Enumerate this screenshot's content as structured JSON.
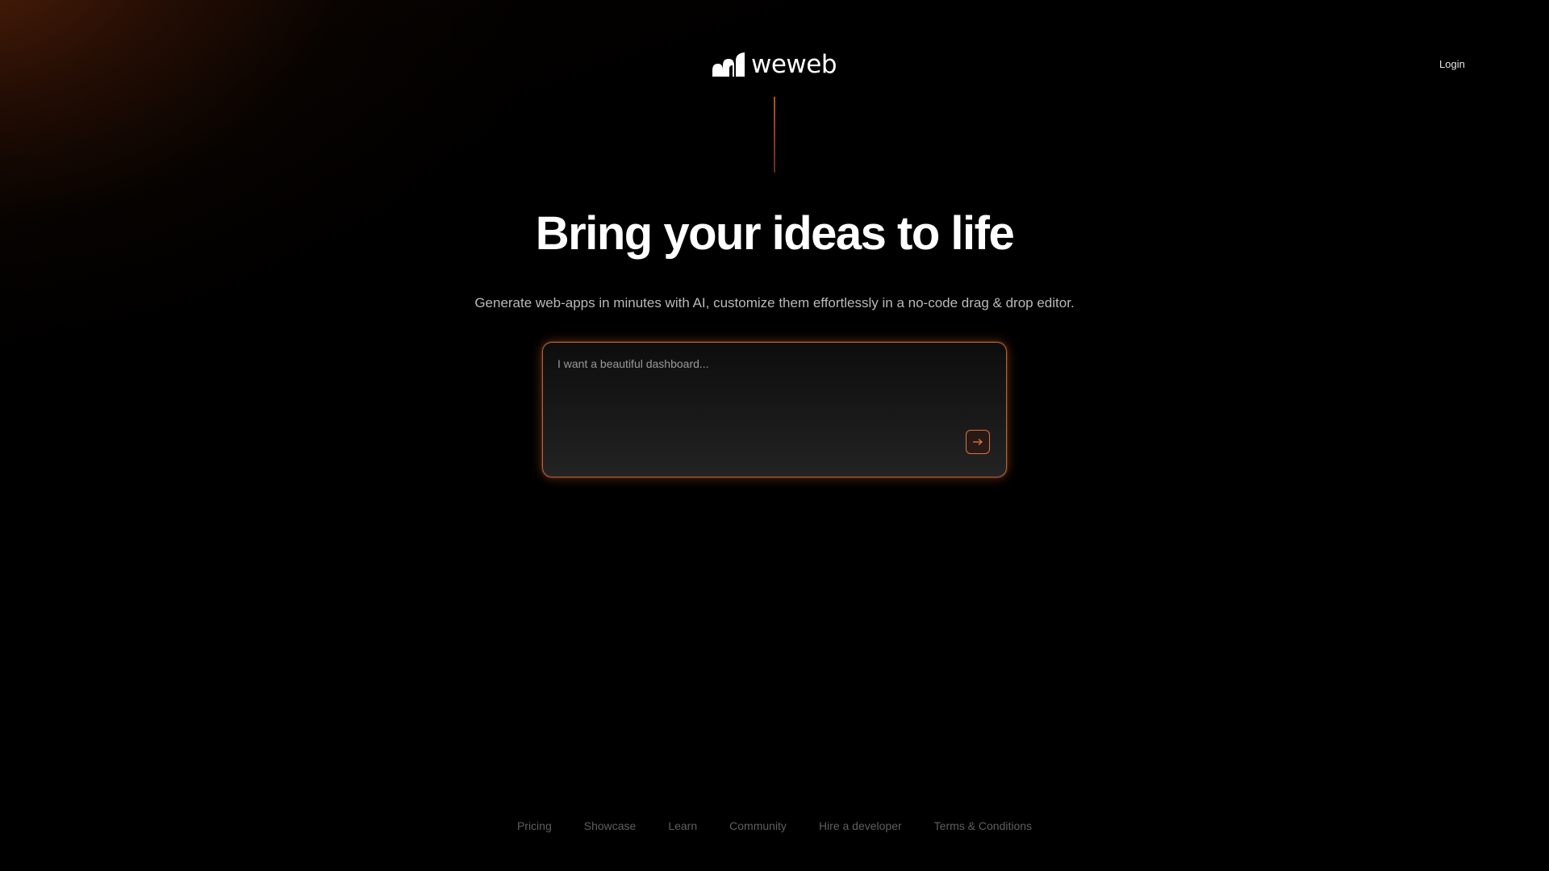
{
  "header": {
    "brand": "weweb",
    "login_label": "Login"
  },
  "hero": {
    "title": "Bring your ideas to life",
    "subtitle": "Generate web-apps in minutes with AI, customize them effortlessly in a no-code drag & drop editor."
  },
  "prompt": {
    "placeholder": "I want a beautiful dashboard...",
    "value": "",
    "submit_icon": "arrow-right-icon"
  },
  "footer": {
    "links": [
      "Pricing",
      "Showcase",
      "Learn",
      "Community",
      "Hire a developer",
      "Terms & Conditions"
    ]
  },
  "colors": {
    "accent": "#e0703a",
    "background": "#000000",
    "gradient_glow": "#5e240a"
  }
}
